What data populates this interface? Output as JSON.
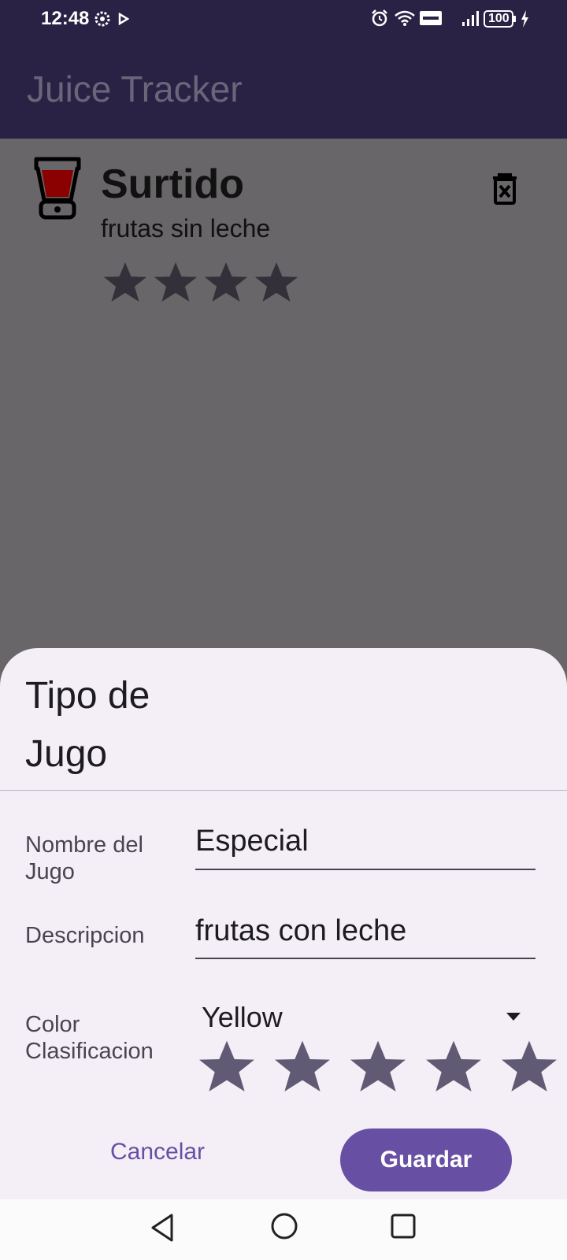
{
  "status_bar": {
    "time": "12:48",
    "battery": "100"
  },
  "app_bar": {
    "title": "Juice Tracker"
  },
  "juice_list": [
    {
      "name": "Surtido",
      "description": "frutas sin leche",
      "rating": 4
    }
  ],
  "sheet": {
    "title": "Tipo de Jugo",
    "name_label": "Nombre del Jugo",
    "name_value": "Especial",
    "description_label": "Descripcion",
    "description_value": "frutas con leche",
    "color_label": "Color",
    "color_value": "Yellow",
    "rating_label": "Clasificacion",
    "rating_value": 5,
    "rating_max": 5,
    "cancel_label": "Cancelar",
    "save_label": "Guardar"
  },
  "colors": {
    "app_bar": "#292244",
    "scrim": "#686668",
    "sheet": "#f4eff7",
    "primary": "#6750a4",
    "star_filled": "#615a74",
    "juice_fill": "#8b0000"
  }
}
